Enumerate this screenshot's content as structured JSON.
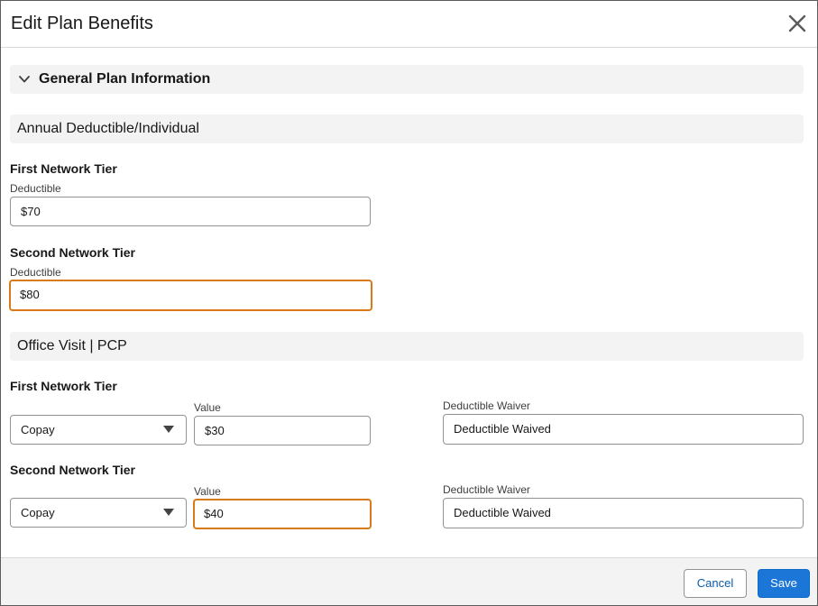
{
  "modal": {
    "title": "Edit Plan Benefits",
    "close_icon": "close-icon"
  },
  "general_section": {
    "label": "General Plan Information",
    "chevron_icon": "chevron-down-icon",
    "expanded": true
  },
  "annual_deductible": {
    "label": "Annual Deductible/Individual",
    "first_tier": {
      "title": "First Network Tier",
      "deductible_label": "Deductible",
      "deductible_value": "$70"
    },
    "second_tier": {
      "title": "Second Network Tier",
      "deductible_label": "Deductible",
      "deductible_value": "$80"
    }
  },
  "office_visit": {
    "label": "Office Visit | PCP",
    "first_tier": {
      "title": "First Network Tier",
      "type_value": "Copay",
      "value_label": "Value",
      "value": "$30",
      "waiver_label": "Deductible Waiver",
      "waiver_value": "Deductible Waived"
    },
    "second_tier": {
      "title": "Second Network Tier",
      "type_value": "Copay",
      "value_label": "Value",
      "value": "$40",
      "waiver_label": "Deductible Waiver",
      "waiver_value": "Deductible Waived"
    }
  },
  "footer": {
    "cancel_label": "Cancel",
    "save_label": "Save"
  },
  "colors": {
    "accent": "#1b76d8",
    "focus_border": "#d97a16",
    "section_bg": "#f3f3f3"
  }
}
